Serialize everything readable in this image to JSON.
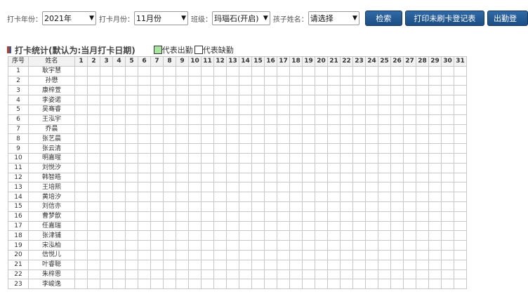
{
  "toolbar": {
    "year_label": "打卡年份：",
    "year_value": "2021年",
    "month_label": "打卡月份：",
    "month_value": "11月份",
    "class_label": "班级：",
    "class_value": "玛瑙石(开启)",
    "child_label": "孩子姓名：",
    "child_value": "请选择",
    "search_button": "检索",
    "print_button": "打印未刷卡登记表",
    "attendance_button": "出勤登"
  },
  "stats": {
    "title": "打卡统计(默认为:当月打卡日期)",
    "legend_present": "代表出勤",
    "legend_absent": "代表缺勤",
    "present_color": "#a8e6a0",
    "absent_color": "#ffffff",
    "marker_colors": [
      "#c0392b",
      "#3a5f8f"
    ]
  },
  "table": {
    "header_index": "序号",
    "header_name": "姓名",
    "days": [
      "1",
      "2",
      "3",
      "4",
      "5",
      "6",
      "7",
      "8",
      "9",
      "10",
      "11",
      "12",
      "13",
      "14",
      "15",
      "16",
      "17",
      "18",
      "19",
      "20",
      "21",
      "22",
      "23",
      "24",
      "25",
      "26",
      "27",
      "28",
      "29",
      "30",
      "31"
    ],
    "rows": [
      {
        "index": "1",
        "name": "耿宇慧"
      },
      {
        "index": "2",
        "name": "孙懋"
      },
      {
        "index": "3",
        "name": "康梓萱"
      },
      {
        "index": "4",
        "name": "李姿诺"
      },
      {
        "index": "5",
        "name": "吴骞睿"
      },
      {
        "index": "6",
        "name": "王泓宇"
      },
      {
        "index": "7",
        "name": "乔晨"
      },
      {
        "index": "8",
        "name": "张艺晨"
      },
      {
        "index": "9",
        "name": "张云清"
      },
      {
        "index": "10",
        "name": "明嘉瑆"
      },
      {
        "index": "11",
        "name": "刘悦汐"
      },
      {
        "index": "12",
        "name": "韩智皓"
      },
      {
        "index": "13",
        "name": "王培熙"
      },
      {
        "index": "14",
        "name": "黄培汐"
      },
      {
        "index": "15",
        "name": "刘信亦"
      },
      {
        "index": "16",
        "name": "曹梦歆"
      },
      {
        "index": "17",
        "name": "任嘉瑞"
      },
      {
        "index": "18",
        "name": "张津铺"
      },
      {
        "index": "19",
        "name": "宋泓柏"
      },
      {
        "index": "20",
        "name": "信悦儿"
      },
      {
        "index": "21",
        "name": "叶睿聪"
      },
      {
        "index": "22",
        "name": "朱梓恩"
      },
      {
        "index": "23",
        "name": "李峻逸"
      }
    ]
  }
}
